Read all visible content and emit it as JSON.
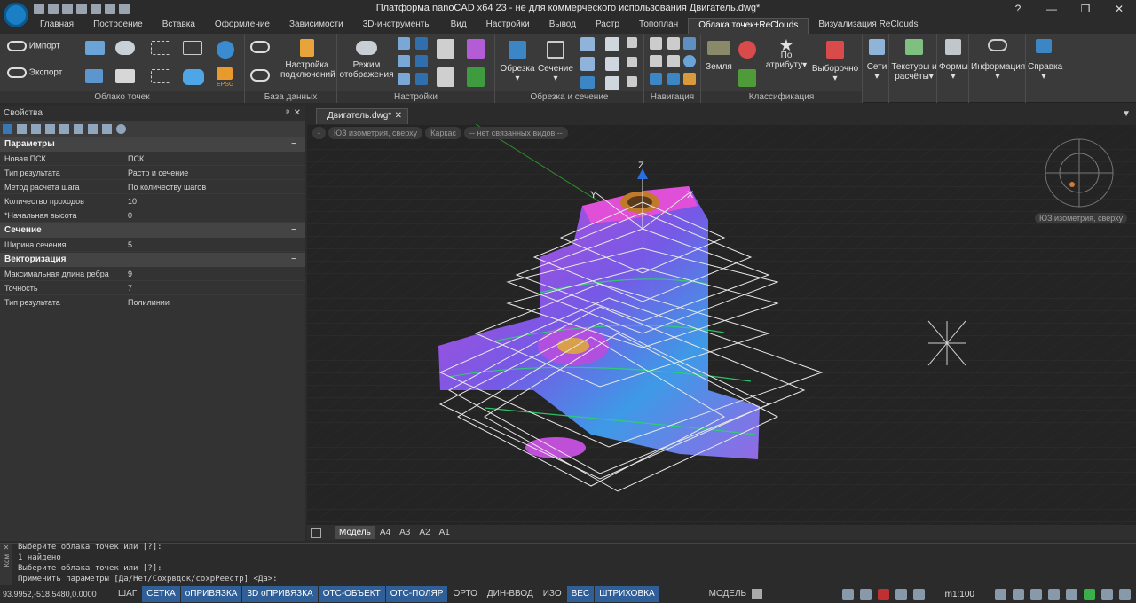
{
  "window": {
    "title": "Платформа nanoCAD x64 23 - не для коммерческого использования Двигатель.dwg*"
  },
  "menu": {
    "tabs": [
      {
        "label": "Главная"
      },
      {
        "label": "Построение"
      },
      {
        "label": "Вставка"
      },
      {
        "label": "Оформление"
      },
      {
        "label": "Зависимости"
      },
      {
        "label": "3D-инструменты"
      },
      {
        "label": "Вид"
      },
      {
        "label": "Настройки"
      },
      {
        "label": "Вывод"
      },
      {
        "label": "Растр"
      },
      {
        "label": "Топоплан"
      },
      {
        "label": "Облака точек+ReClouds"
      },
      {
        "label": "Визуализация ReClouds"
      }
    ]
  },
  "ribbon": {
    "import_label": "Импорт",
    "export_label": "Экспорт",
    "connection_settings": "Настройка подключений",
    "display_mode": "Режим отображения",
    "clip": "Обрезка",
    "section": "Сечение",
    "ground": "Земля",
    "by_attribute": "По атрибуту",
    "selective": "Выборочно",
    "nets": "Сети",
    "textures": "Текстуры и расчёты",
    "forms": "Формы",
    "info": "Информация",
    "help": "Справка",
    "epsg": "EPSG",
    "groups": {
      "pointcloud": "Облако точек",
      "database": "База данных",
      "settings": "Настройки",
      "clip_section": "Обрезка и сечение",
      "navigation": "Навигация",
      "classification": "Классификация"
    }
  },
  "properties": {
    "title": "Свойства",
    "sections": [
      {
        "label": "Параметры",
        "rows": [
          {
            "key": "Новая ПСК",
            "value": "ПСК"
          },
          {
            "key": "Тип результата",
            "value": "Растр и сечение"
          },
          {
            "key": "Метод расчета шага",
            "value": "По количеству шагов"
          },
          {
            "key": "Количество проходов",
            "value": "10"
          },
          {
            "key": "*Начальная высота",
            "value": "0"
          }
        ]
      },
      {
        "label": "Сечение",
        "rows": [
          {
            "key": "Ширина сечения",
            "value": "5"
          }
        ]
      },
      {
        "label": "Векторизация",
        "rows": [
          {
            "key": "Максимальная длина ребра",
            "value": "9"
          },
          {
            "key": "Точность",
            "value": "7"
          },
          {
            "key": "Тип результата",
            "value": "Полилинии"
          }
        ]
      }
    ]
  },
  "document": {
    "tab": "Двигатель.dwg*"
  },
  "viewport": {
    "chips": [
      "-",
      "ЮЗ изометрия, сверху",
      "Каркас",
      "-- нет связанных видов --"
    ],
    "viewcube_label": "ЮЗ изометрия, сверху",
    "axis_z": "Z",
    "axis_y": "Y",
    "axis_x": "X"
  },
  "layouts": [
    "Модель",
    "А4",
    "А3",
    "А2",
    "А1"
  ],
  "command": {
    "side": "Ком",
    "lines": [
      "Выберите облака точек или [?]:",
      "1 найдено",
      "Выберите облака точек или [?]:",
      "Применить параметры [Да/Нет/Сохрвдок/сохрРеестр] <Да>:"
    ]
  },
  "status": {
    "coords": "93.9952,-518.5480,0.0000",
    "buttons": [
      {
        "label": "ШАГ",
        "on": false
      },
      {
        "label": "СЕТКА",
        "on": true
      },
      {
        "label": "оПРИВЯЗКА",
        "on": true
      },
      {
        "label": "3D оПРИВЯЗКА",
        "on": true
      },
      {
        "label": "ОТС-ОБЪЕКТ",
        "on": true
      },
      {
        "label": "ОТС-ПОЛЯР",
        "on": true
      },
      {
        "label": "ОРТО",
        "on": false
      },
      {
        "label": "ДИН-ВВОД",
        "on": false
      },
      {
        "label": "ИЗО",
        "on": false
      },
      {
        "label": "ВЕС",
        "on": true
      },
      {
        "label": "ШТРИХОВКА",
        "on": true
      }
    ],
    "model": "МОДЕЛЬ",
    "scale": "m1:100"
  }
}
